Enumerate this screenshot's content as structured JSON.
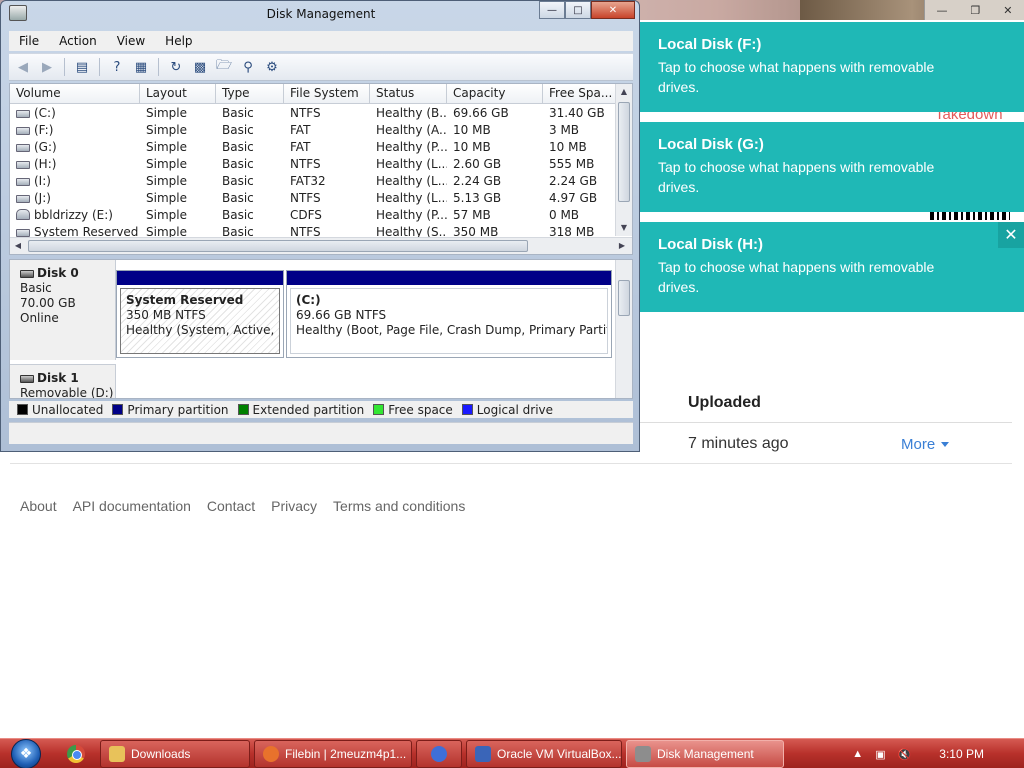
{
  "background": {
    "takedown": "Takedown",
    "uploaded_label": "Uploaded",
    "uploaded_value": "7 minutes ago",
    "more_label": "More",
    "footer_links": [
      "About",
      "API documentation",
      "Contact",
      "Privacy",
      "Terms and conditions"
    ]
  },
  "notifications": [
    {
      "title": "Local Disk (F:)",
      "body": "Tap to choose what happens with removable drives."
    },
    {
      "title": "Local Disk (G:)",
      "body": "Tap to choose what happens with removable drives."
    },
    {
      "title": "Local Disk (H:)",
      "body": "Tap to choose what happens with removable drives."
    }
  ],
  "window": {
    "title": "Disk Management",
    "menu": [
      "File",
      "Action",
      "View",
      "Help"
    ],
    "columns": [
      "Volume",
      "Layout",
      "Type",
      "File System",
      "Status",
      "Capacity",
      "Free Spa..."
    ],
    "rows": [
      [
        "(C:)",
        "Simple",
        "Basic",
        "NTFS",
        "Healthy (B...",
        "69.66 GB",
        "31.40 GB"
      ],
      [
        "(F:)",
        "Simple",
        "Basic",
        "FAT",
        "Healthy (A...",
        "10 MB",
        "3 MB"
      ],
      [
        "(G:)",
        "Simple",
        "Basic",
        "FAT",
        "Healthy (P...",
        "10 MB",
        "10 MB"
      ],
      [
        "(H:)",
        "Simple",
        "Basic",
        "NTFS",
        "Healthy (L...",
        "2.60 GB",
        "555 MB"
      ],
      [
        "(I:)",
        "Simple",
        "Basic",
        "FAT32",
        "Healthy (L...",
        "2.24 GB",
        "2.24 GB"
      ],
      [
        "(J:)",
        "Simple",
        "Basic",
        "NTFS",
        "Healthy (L...",
        "5.13 GB",
        "4.97 GB"
      ],
      [
        "bbldrizzy (E:)",
        "Simple",
        "Basic",
        "CDFS",
        "Healthy (P...",
        "57 MB",
        "0 MB"
      ],
      [
        "System Reserved",
        "Simple",
        "Basic",
        "NTFS",
        "Healthy (S...",
        "350 MB",
        "318 MB"
      ]
    ],
    "disk0": {
      "name": "Disk 0",
      "type": "Basic",
      "size": "70.00 GB",
      "state": "Online",
      "sys_name": "System Reserved",
      "sys_size": "350 MB NTFS",
      "sys_status": "Healthy (System, Active, Primary Partition)",
      "c_name": "(C:)",
      "c_size": "69.66 GB NTFS",
      "c_status": "Healthy (Boot, Page File, Crash Dump, Primary Partition)"
    },
    "disk1": {
      "name": "Disk 1",
      "type": "Removable (D:)"
    },
    "legend": [
      {
        "label": "Unallocated",
        "color": "#000000"
      },
      {
        "label": "Primary partition",
        "color": "#000087"
      },
      {
        "label": "Extended partition",
        "color": "#008000"
      },
      {
        "label": "Free space",
        "color": "#33e633"
      },
      {
        "label": "Logical drive",
        "color": "#1a1aff"
      }
    ]
  },
  "taskbar": {
    "items": [
      {
        "label": "Downloads",
        "icon": "folder-icon",
        "color": "#e8c25a"
      },
      {
        "label": "Filebin | 2meuzm4p1...",
        "icon": "firefox-icon",
        "color": "#e8722c"
      },
      {
        "label": "",
        "icon": "firefox-alt-icon",
        "color": "#3f6fd8"
      },
      {
        "label": "Oracle VM VirtualBox...",
        "icon": "virtualbox-icon",
        "color": "#3a65b8"
      },
      {
        "label": "Disk Management",
        "icon": "disk-management-icon",
        "color": "#8d8d8d"
      }
    ],
    "clock": "3:10 PM"
  }
}
